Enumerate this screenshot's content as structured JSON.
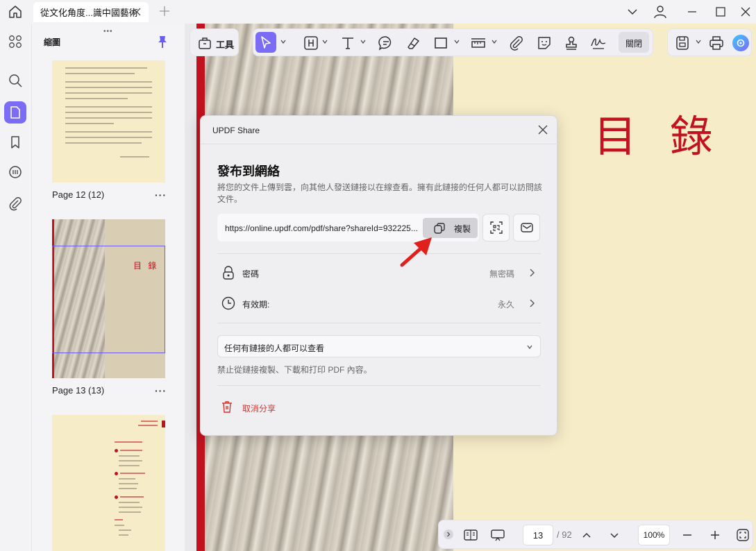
{
  "titlebar": {
    "tab_title": "從文化角度...識中國藝術"
  },
  "sidebar": {
    "title": "縮圖",
    "pages": [
      {
        "label": "Page 12 (12)",
        "more": "···"
      },
      {
        "label": "Page 13 (13)",
        "more": "···"
      }
    ],
    "thumb13_title": "目 錄"
  },
  "toolbar": {
    "tools_label": "工具",
    "close_label": "關閉"
  },
  "document": {
    "heading": "目 錄"
  },
  "dialog": {
    "title": "UPDF Share",
    "heading": "發布到網絡",
    "description": "將您的文件上傳到雲，向其他人發送鏈接以在線查看。擁有此鏈接的任何人都可以訪問該文件。",
    "link": "https://online.updf.com/pdf/share?shareId=932225...",
    "copy_label": "複製",
    "password_label": "密碼",
    "password_value": "無密碼",
    "expiry_label": "有效期:",
    "expiry_value": "永久",
    "permission": "任何有鏈接的人都可以查看",
    "note": "禁止從鏈接複製、下載和打印 PDF 內容。",
    "cancel_share": "取消分享"
  },
  "bottombar": {
    "current_page": "13",
    "total_pages": "/ 92",
    "zoom": "100%"
  },
  "colors": {
    "accent": "#7b6cf6",
    "doc_red": "#c1121f",
    "cancel_red": "#d9302c"
  }
}
